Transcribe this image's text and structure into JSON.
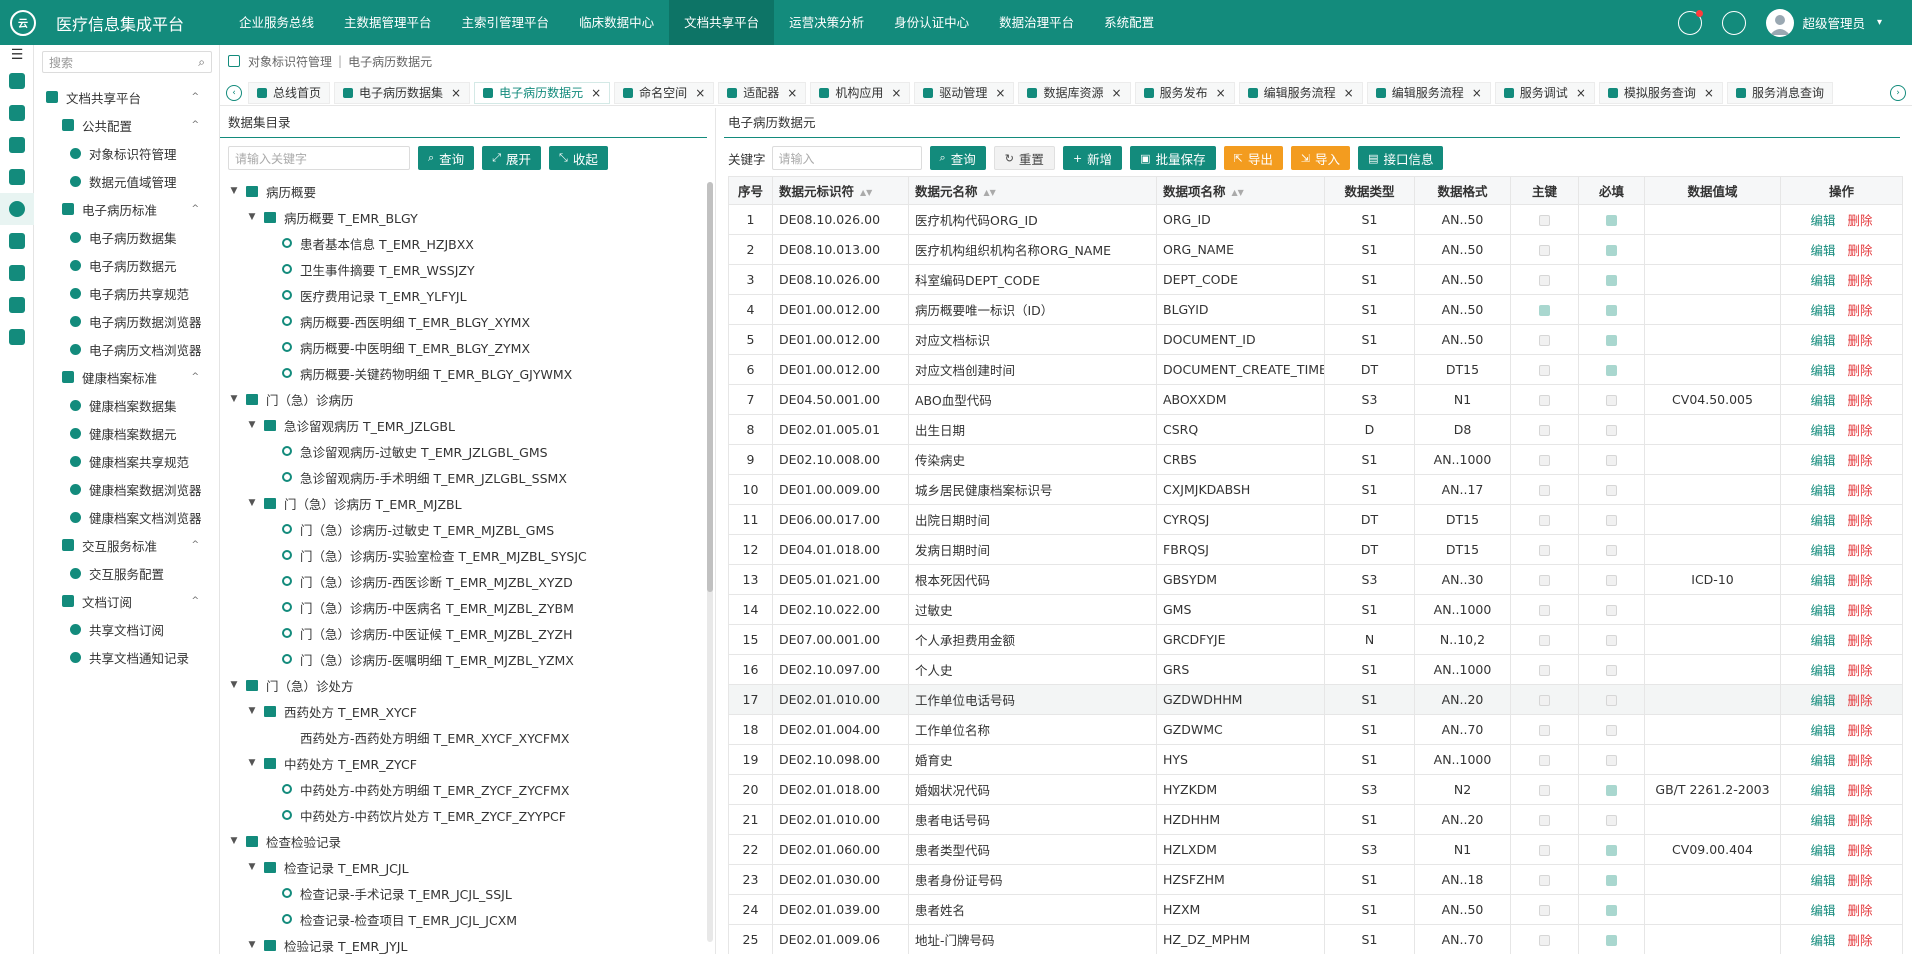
{
  "app": {
    "logo_text": "云",
    "title": "医疗信息集成平台",
    "nav": [
      "企业服务总线",
      "主数据管理平台",
      "主索引管理平台",
      "临床数据中心",
      "文档共享平台",
      "运营决策分析",
      "身份认证中心",
      "数据治理平台",
      "系统配置"
    ],
    "active_nav_index": 4,
    "user_name": "超级管理员",
    "user_caret": "▾"
  },
  "colors": {
    "primary": "#138b7c",
    "danger": "#e4393c",
    "warning": "#f39c1f"
  },
  "rail_icons": [
    "shield-icon",
    "grid-icon",
    "bookmark-icon",
    "database-icon",
    "shield-active-icon",
    "briefcase-icon",
    "user-icon",
    "cards-icon",
    "gear-icon"
  ],
  "sidebar": {
    "menu_icon": "☰",
    "search_placeholder": "搜索",
    "search_icon": "⌕",
    "items": [
      {
        "level": 0,
        "label": "文档共享平台",
        "icon": "shield-icon",
        "arrow": "^"
      },
      {
        "level": 1,
        "label": "公共配置",
        "icon": "gear-icon",
        "arrow": "^"
      },
      {
        "level": 2,
        "label": "对象标识符管理",
        "icon": "circle-icon"
      },
      {
        "level": 2,
        "label": "数据元值域管理",
        "icon": "doc-icon"
      },
      {
        "level": 1,
        "label": "电子病历标准",
        "icon": "gear-icon",
        "arrow": "^"
      },
      {
        "level": 2,
        "label": "电子病历数据集",
        "icon": "doc-icon"
      },
      {
        "level": 2,
        "label": "电子病历数据元",
        "icon": "doc-icon"
      },
      {
        "level": 2,
        "label": "电子病历共享规范",
        "icon": "circle-icon"
      },
      {
        "level": 2,
        "label": "电子病历数据浏览器",
        "icon": "circle-icon"
      },
      {
        "level": 2,
        "label": "电子病历文档浏览器",
        "icon": "grid-icon"
      },
      {
        "level": 1,
        "label": "健康档案标准",
        "icon": "doc-icon",
        "arrow": "^"
      },
      {
        "level": 2,
        "label": "健康档案数据集",
        "icon": "doc-icon"
      },
      {
        "level": 2,
        "label": "健康档案数据元",
        "icon": "grid-icon"
      },
      {
        "level": 2,
        "label": "健康档案共享规范",
        "icon": "doc-icon"
      },
      {
        "level": 2,
        "label": "健康档案数据浏览器",
        "icon": "doc-icon"
      },
      {
        "level": 2,
        "label": "健康档案文档浏览器",
        "icon": "db-icon"
      },
      {
        "level": 1,
        "label": "交互服务标准",
        "icon": "gear-icon",
        "arrow": "^"
      },
      {
        "level": 2,
        "label": "交互服务配置",
        "icon": "doc-icon"
      },
      {
        "level": 1,
        "label": "文档订阅",
        "icon": "circle-icon",
        "arrow": "^"
      },
      {
        "level": 2,
        "label": "共享文档订阅",
        "icon": "doc-icon"
      },
      {
        "level": 2,
        "label": "共享文档通知记录",
        "icon": "chart-icon"
      }
    ]
  },
  "breadcrumb": [
    "对象标识符管理",
    "电子病历数据元"
  ],
  "tabs": {
    "prev_icon": "‹",
    "next_icon": "›",
    "close_icon": "×",
    "items": [
      {
        "label": "总线首页",
        "closable": false
      },
      {
        "label": "电子病历数据集",
        "closable": true
      },
      {
        "label": "电子病历数据元",
        "closable": true,
        "active": true
      },
      {
        "label": "命名空间",
        "closable": true
      },
      {
        "label": "适配器",
        "closable": true
      },
      {
        "label": "机构应用",
        "closable": true
      },
      {
        "label": "驱动管理",
        "closable": true
      },
      {
        "label": "数据库资源",
        "closable": true
      },
      {
        "label": "服务发布",
        "closable": true
      },
      {
        "label": "编辑服务流程",
        "closable": true
      },
      {
        "label": "编辑服务流程",
        "closable": true
      },
      {
        "label": "服务调试",
        "closable": true
      },
      {
        "label": "模拟服务查询",
        "closable": true
      },
      {
        "label": "服务消息查询",
        "closable": false
      }
    ]
  },
  "left_panel": {
    "title": "数据集目录",
    "search_placeholder": "请输入关键字",
    "buttons": [
      {
        "icon": "⌕",
        "label": "查询"
      },
      {
        "icon": "⤢",
        "label": "展开"
      },
      {
        "icon": "⤡",
        "label": "收起"
      }
    ],
    "toggle_open": "▼",
    "tree": [
      {
        "level": 0,
        "type": "folder",
        "label": "病历概要"
      },
      {
        "level": 1,
        "type": "folder",
        "label": "病历概要 T_EMR_BLGY"
      },
      {
        "level": 2,
        "type": "leaf",
        "label": "患者基本信息 T_EMR_HZJBXX"
      },
      {
        "level": 2,
        "type": "leaf",
        "label": "卫生事件摘要 T_EMR_WSSJZY"
      },
      {
        "level": 2,
        "type": "leaf",
        "label": "医疗费用记录 T_EMR_YLFYJL"
      },
      {
        "level": 2,
        "type": "leaf",
        "label": "病历概要-西医明细 T_EMR_BLGY_XYMX"
      },
      {
        "level": 2,
        "type": "leaf",
        "label": "病历概要-中医明细 T_EMR_BLGY_ZYMX"
      },
      {
        "level": 2,
        "type": "leaf",
        "label": "病历概要-关键药物明细 T_EMR_BLGY_GJYWMX"
      },
      {
        "level": 0,
        "type": "folder",
        "label": "门（急）诊病历"
      },
      {
        "level": 1,
        "type": "folder",
        "label": "急诊留观病历 T_EMR_JZLGBL"
      },
      {
        "level": 2,
        "type": "leaf",
        "label": "急诊留观病历-过敏史 T_EMR_JZLGBL_GMS"
      },
      {
        "level": 2,
        "type": "leaf",
        "label": "急诊留观病历-手术明细 T_EMR_JZLGBL_SSMX"
      },
      {
        "level": 1,
        "type": "folder",
        "label": "门（急）诊病历 T_EMR_MJZBL"
      },
      {
        "level": 2,
        "type": "leaf",
        "label": "门（急）诊病历-过敏史 T_EMR_MJZBL_GMS"
      },
      {
        "level": 2,
        "type": "leaf",
        "label": "门（急）诊病历-实验室检查 T_EMR_MJZBL_SYSJC"
      },
      {
        "level": 2,
        "type": "leaf",
        "label": "门（急）诊病历-西医诊断 T_EMR_MJZBL_XYZD"
      },
      {
        "level": 2,
        "type": "leaf",
        "label": "门（急）诊病历-中医病名 T_EMR_MJZBL_ZYBM"
      },
      {
        "level": 2,
        "type": "leaf",
        "label": "门（急）诊病历-中医证候 T_EMR_MJZBL_ZYZH"
      },
      {
        "level": 2,
        "type": "leaf",
        "label": "门（急）诊病历-医嘱明细 T_EMR_MJZBL_YZMX"
      },
      {
        "level": 0,
        "type": "folder",
        "label": "门（急）诊处方"
      },
      {
        "level": 1,
        "type": "folder",
        "label": "西药处方 T_EMR_XYCF"
      },
      {
        "level": 2,
        "type": "doc",
        "label": "西药处方-西药处方明细 T_EMR_XYCF_XYCFMX"
      },
      {
        "level": 1,
        "type": "folder",
        "label": "中药处方 T_EMR_ZYCF"
      },
      {
        "level": 2,
        "type": "leaf",
        "label": "中药处方-中药处方明细 T_EMR_ZYCF_ZYCFMX"
      },
      {
        "level": 2,
        "type": "leaf",
        "label": "中药处方-中药饮片处方 T_EMR_ZYCF_ZYYPCF"
      },
      {
        "level": 0,
        "type": "folder",
        "label": "检查检验记录"
      },
      {
        "level": 1,
        "type": "folder",
        "label": "检查记录 T_EMR_JCJL"
      },
      {
        "level": 2,
        "type": "leaf",
        "label": "检查记录-手术记录 T_EMR_JCJL_SSJL"
      },
      {
        "level": 2,
        "type": "leaf",
        "label": "检查记录-检查项目 T_EMR_JCJL_JCXM"
      },
      {
        "level": 1,
        "type": "folder",
        "label": "检验记录 T_EMR_JYJL"
      }
    ]
  },
  "right_panel": {
    "title": "电子病历数据元",
    "keyword_label": "关键字",
    "search_placeholder": "请输入",
    "buttons": [
      {
        "icon": "⌕",
        "label": "查询",
        "style": "primary"
      },
      {
        "icon": "↻",
        "label": "重置",
        "style": "plain"
      },
      {
        "icon": "+",
        "label": "新增",
        "style": "primary"
      },
      {
        "icon": "▣",
        "label": "批量保存",
        "style": "primary"
      },
      {
        "icon": "⇱",
        "label": "导出",
        "style": "orange"
      },
      {
        "icon": "⇲",
        "label": "导入",
        "style": "orange"
      },
      {
        "icon": "▤",
        "label": "接口信息",
        "style": "primary"
      }
    ],
    "columns": [
      "序号",
      "数据元标识符",
      "数据元名称",
      "数据项名称",
      "数据类型",
      "数据格式",
      "主键",
      "必填",
      "数据值域",
      "操作"
    ],
    "sort_icon": "▲▼",
    "edit_label": "编辑",
    "delete_label": "删除",
    "rows": [
      [
        "1",
        "DE08.10.026.00",
        "医疗机构代码ORG_ID",
        "ORG_ID",
        "S1",
        "AN..50",
        false,
        true,
        ""
      ],
      [
        "2",
        "DE08.10.013.00",
        "医疗机构组织机构名称ORG_NAME",
        "ORG_NAME",
        "S1",
        "AN..50",
        false,
        true,
        ""
      ],
      [
        "3",
        "DE08.10.026.00",
        "科室编码DEPT_CODE",
        "DEPT_CODE",
        "S1",
        "AN..50",
        false,
        true,
        ""
      ],
      [
        "4",
        "DE01.00.012.00",
        "病历概要唯一标识（ID）",
        "BLGYID",
        "S1",
        "AN..50",
        true,
        true,
        ""
      ],
      [
        "5",
        "DE01.00.012.00",
        "对应文档标识",
        "DOCUMENT_ID",
        "S1",
        "AN..50",
        false,
        true,
        ""
      ],
      [
        "6",
        "DE01.00.012.00",
        "对应文档创建时间",
        "DOCUMENT_CREATE_TIME",
        "DT",
        "DT15",
        false,
        true,
        ""
      ],
      [
        "7",
        "DE04.50.001.00",
        "ABO血型代码",
        "ABOXXDM",
        "S3",
        "N1",
        false,
        false,
        "CV04.50.005"
      ],
      [
        "8",
        "DE02.01.005.01",
        "出生日期",
        "CSRQ",
        "D",
        "D8",
        false,
        false,
        ""
      ],
      [
        "9",
        "DE02.10.008.00",
        "传染病史",
        "CRBS",
        "S1",
        "AN..1000",
        false,
        false,
        ""
      ],
      [
        "10",
        "DE01.00.009.00",
        "城乡居民健康档案标识号",
        "CXJMJKDABSH",
        "S1",
        "AN..17",
        false,
        false,
        ""
      ],
      [
        "11",
        "DE06.00.017.00",
        "出院日期时间",
        "CYRQSJ",
        "DT",
        "DT15",
        false,
        false,
        ""
      ],
      [
        "12",
        "DE04.01.018.00",
        "发病日期时间",
        "FBRQSJ",
        "DT",
        "DT15",
        false,
        false,
        ""
      ],
      [
        "13",
        "DE05.01.021.00",
        "根本死因代码",
        "GBSYDM",
        "S3",
        "AN..30",
        false,
        false,
        "ICD-10"
      ],
      [
        "14",
        "DE02.10.022.00",
        "过敏史",
        "GMS",
        "S1",
        "AN..1000",
        false,
        false,
        ""
      ],
      [
        "15",
        "DE07.00.001.00",
        "个人承担费用金额",
        "GRCDFYJE",
        "N",
        "N..10,2",
        false,
        false,
        ""
      ],
      [
        "16",
        "DE02.10.097.00",
        "个人史",
        "GRS",
        "S1",
        "AN..1000",
        false,
        false,
        ""
      ],
      [
        "17",
        "DE02.01.010.00",
        "工作单位电话号码",
        "GZDWDHHM",
        "S1",
        "AN..20",
        false,
        false,
        ""
      ],
      [
        "18",
        "DE02.01.004.00",
        "工作单位名称",
        "GZDWMC",
        "S1",
        "AN..70",
        false,
        false,
        ""
      ],
      [
        "19",
        "DE02.10.098.00",
        "婚育史",
        "HYS",
        "S1",
        "AN..1000",
        false,
        false,
        ""
      ],
      [
        "20",
        "DE02.01.018.00",
        "婚姻状况代码",
        "HYZKDM",
        "S3",
        "N2",
        false,
        true,
        "GB/T 2261.2-2003"
      ],
      [
        "21",
        "DE02.01.010.00",
        "患者电话号码",
        "HZDHHM",
        "S1",
        "AN..20",
        false,
        false,
        ""
      ],
      [
        "22",
        "DE02.01.060.00",
        "患者类型代码",
        "HZLXDM",
        "S3",
        "N1",
        false,
        true,
        "CV09.00.404"
      ],
      [
        "23",
        "DE02.01.030.00",
        "患者身份证号码",
        "HZSFZHM",
        "S1",
        "AN..18",
        false,
        true,
        ""
      ],
      [
        "24",
        "DE02.01.039.00",
        "患者姓名",
        "HZXM",
        "S1",
        "AN..50",
        false,
        true,
        ""
      ],
      [
        "25",
        "DE02.01.009.06",
        "地址-门牌号码",
        "HZ_DZ_MPHM",
        "S1",
        "AN..70",
        false,
        true,
        ""
      ]
    ],
    "highlight_row": 17
  }
}
